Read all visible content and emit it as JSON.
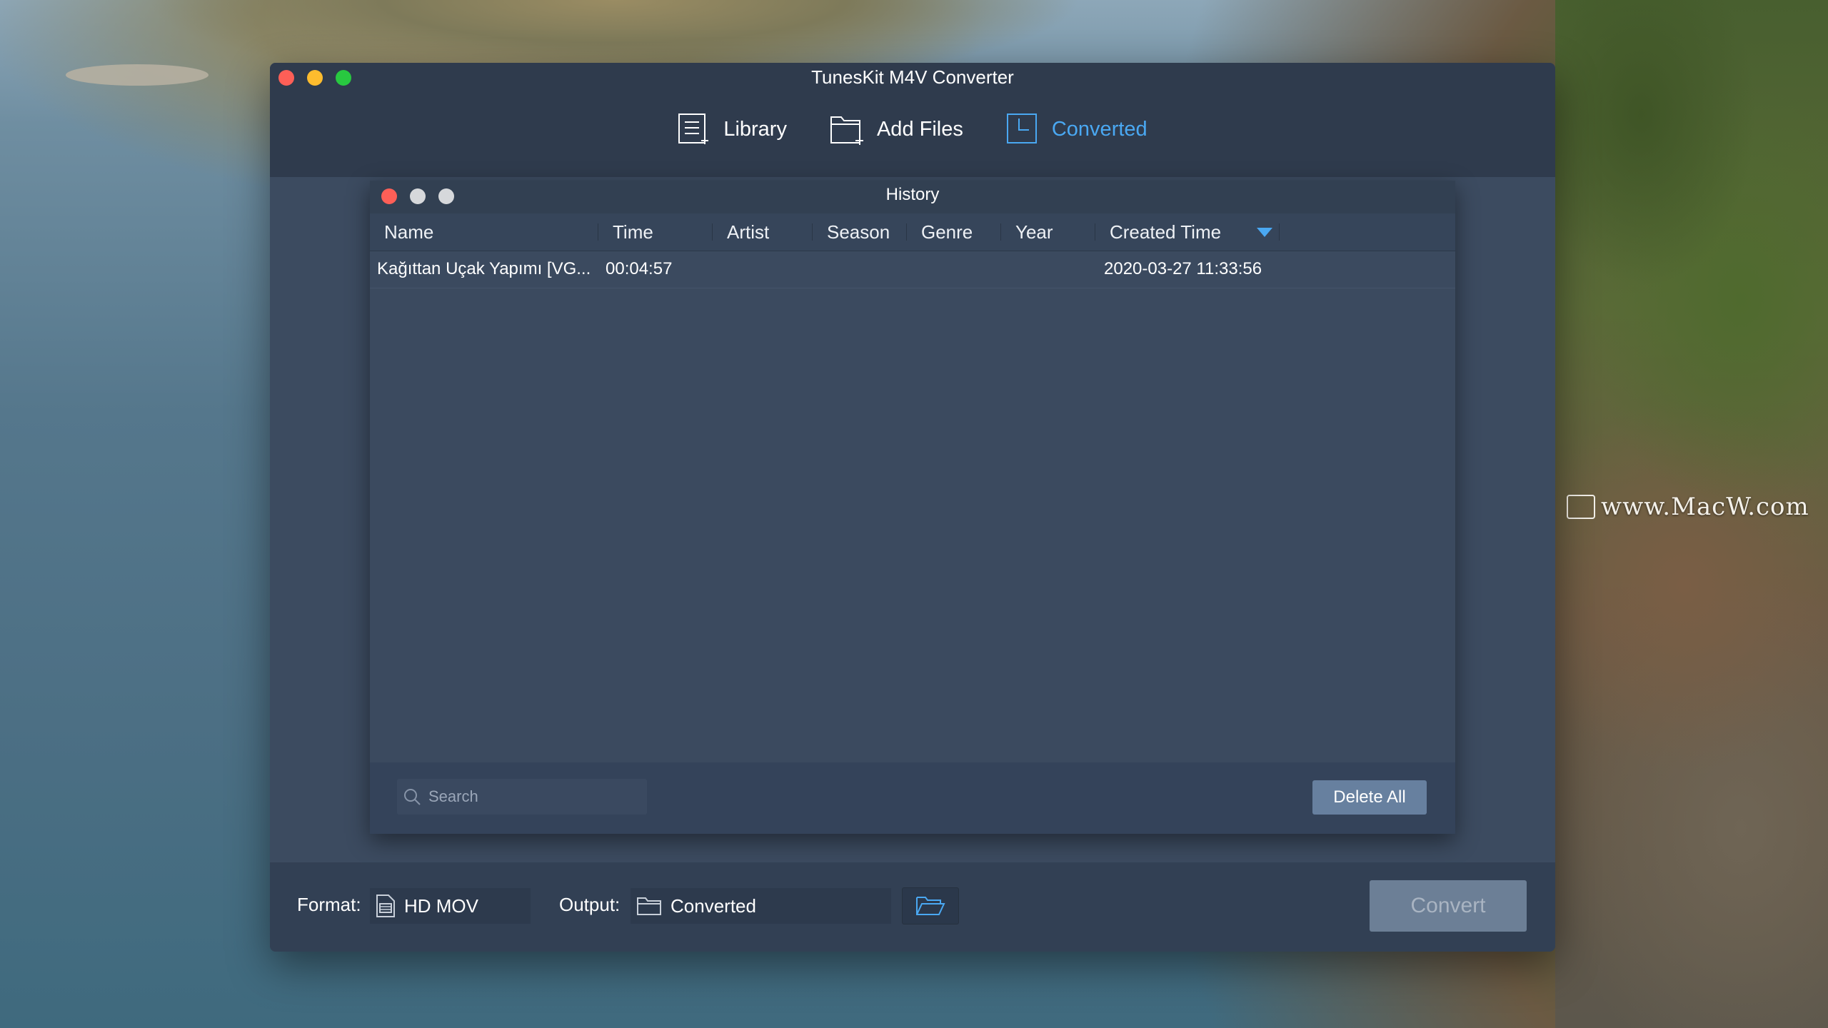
{
  "desktop": {
    "watermark": "www.MacW.com"
  },
  "window": {
    "title": "TunesKit M4V Converter"
  },
  "toolbar": {
    "items": [
      {
        "label": "Library",
        "icon": "library-icon"
      },
      {
        "label": "Add Files",
        "icon": "add-files-icon"
      },
      {
        "label": "Converted",
        "icon": "converted-icon",
        "active": true
      }
    ]
  },
  "history": {
    "title": "History",
    "columns": [
      "Name",
      "Time",
      "Artist",
      "Season",
      "Genre",
      "Year",
      "Created Time"
    ],
    "sort_column": "Created Time",
    "rows": [
      {
        "name": "Kağıttan Uçak Yapımı [VG...",
        "time": "00:04:57",
        "artist": "",
        "season": "",
        "genre": "",
        "year": "",
        "created_time": "2020-03-27 11:33:56"
      }
    ],
    "search_placeholder": "Search",
    "delete_all_label": "Delete All"
  },
  "bottom": {
    "format_label": "Format:",
    "format_value": "HD MOV",
    "output_label": "Output:",
    "output_value": "Converted",
    "convert_label": "Convert"
  },
  "colors": {
    "accent": "#4aa8f2",
    "window_bg": "#3c4b60",
    "titlebar_bg": "#2f3b4d"
  }
}
